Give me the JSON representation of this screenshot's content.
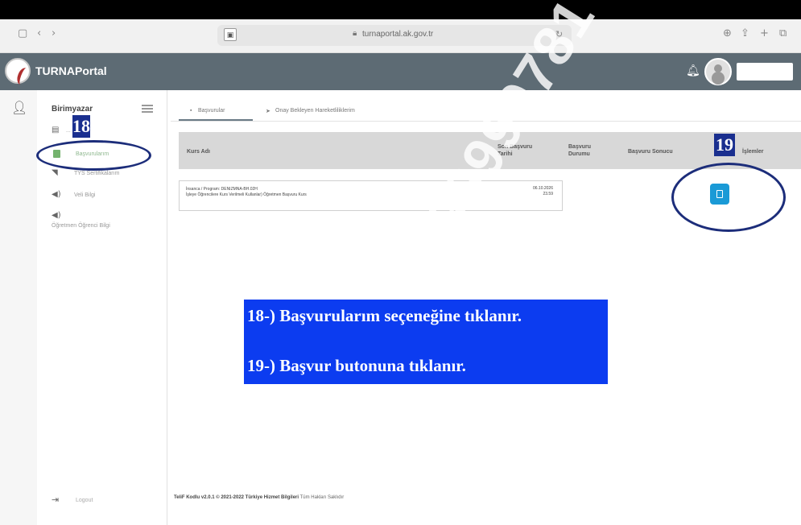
{
  "browser": {
    "url": "turnaportal.ak.gov.tr"
  },
  "header": {
    "title": "TURNAPortal"
  },
  "sidebar": {
    "heading": "Birimyazar",
    "items": [
      {
        "label": "..."
      },
      {
        "label": "Başvurularım"
      },
      {
        "label": "TYS Sertifikalarım"
      },
      {
        "label": "Veli Bilgi"
      },
      {
        "label": "Öğretmen Öğrenci Bilgi"
      }
    ],
    "logout": "Logout"
  },
  "tabs": {
    "active": "Başvurular",
    "other": "Onay Bekleyen Hareketliliklerim"
  },
  "table": {
    "headers": [
      "Kurs Adı",
      "Son Başvuru Tarihi",
      "Başvuru Durumu",
      "Başvuru Sonucu",
      "İşlemler"
    ],
    "row": {
      "line1": "İnsanca / Program: DENIZMNA-BH.02H",
      "line2": "İşleye Öğrencilere Kurs Verilmeli Kullanlar) Öğretmen Başvuru Kurs",
      "date": "06.10.2026",
      "time": "23.59"
    }
  },
  "annotations": {
    "badge18": "18",
    "badge19": "19",
    "step18": "18-) Başvurularım seçeneğine tıklanır.",
    "step19": "19-) Başvur butonuna tıklanır."
  },
  "footer": {
    "text": "TeliF Kodlu v2.0.1 © 2021-2022 Türkiye Hizmet Bilgileri",
    "suffix": "Tüm Hakları Saklıdır"
  },
  "watermark": "4290999781",
  "colors": {
    "header": "#5d6b74",
    "badge": "#1a2f8f",
    "instruction": "#0c3cf0",
    "button": "#1a9ad6"
  }
}
